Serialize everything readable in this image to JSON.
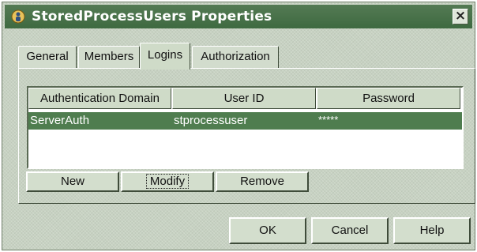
{
  "window": {
    "title": "StoredProcessUsers Properties",
    "close_glyph": "×"
  },
  "tabs": [
    {
      "label": "General",
      "active": false
    },
    {
      "label": "Members",
      "active": false
    },
    {
      "label": "Logins",
      "active": true
    },
    {
      "label": "Authorization",
      "active": false
    }
  ],
  "table": {
    "columns": [
      "Authentication Domain",
      "User ID",
      "Password"
    ],
    "rows": [
      {
        "domain": "ServerAuth",
        "user_id": "stprocessuser",
        "password": "*****",
        "selected": true
      }
    ]
  },
  "table_buttons": {
    "new": "New",
    "modify": "Modify",
    "remove": "Remove"
  },
  "dialog_buttons": {
    "ok": "OK",
    "cancel": "Cancel",
    "help": "Help"
  },
  "colors": {
    "titlebar": "#4a734a",
    "selection": "#4f7d4f",
    "background": "#c7d2c2"
  }
}
